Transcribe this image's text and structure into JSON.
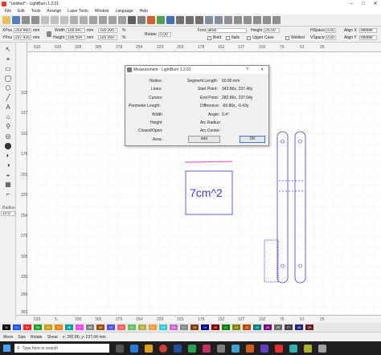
{
  "window": {
    "title": "*untitled* - LightBurn 1.2.01",
    "controls": [
      "–",
      "□",
      "✕"
    ]
  },
  "menu": [
    "File",
    "Edit",
    "Tools",
    "Arrange",
    "Laser Tools",
    "Window",
    "Language",
    "Help"
  ],
  "props": {
    "xpos_label": "XPos",
    "xpos": "263.460",
    "ypos_label": "YPos",
    "ypos": "297.426",
    "width_label": "Width",
    "width": "158.847",
    "height_label": "Height",
    "height": "198.504",
    "unit": "mm",
    "pct_w": "100.000",
    "pct_h": "100.000",
    "pct_sym": "%",
    "rotate_label": "Rotate",
    "rotate": "0.00",
    "font_label": "Font",
    "font": "Arial",
    "height2_label": "Height",
    "height2": "25.00",
    "hspace_label": "HSpace",
    "hspace": "0.00",
    "alignx_label": "Align X",
    "alignx": "Middle",
    "vspace_label": "VSpace",
    "vspace": "0.00",
    "aligny_label": "Align Y",
    "aligny": "Middle",
    "bold": "Bold",
    "italic": "Italic",
    "upper": "Upper Case",
    "welded": "Welded"
  },
  "left_tools": {
    "radius_label": "Radius",
    "radius": "10.0"
  },
  "ruler": {
    "top": [
      "533",
      "530",
      "328",
      "305",
      "279",
      "254",
      "229",
      "203",
      "178",
      "152",
      "127",
      "102",
      "76",
      "51",
      "25"
    ],
    "left": [
      "102",
      "127",
      "152",
      "178",
      "203",
      "229",
      "254",
      "279",
      "305",
      "330",
      "356",
      "381",
      "406",
      "432"
    ],
    "bottom": [
      "533",
      "5..",
      "330",
      "305",
      "279",
      "254",
      "229",
      "203",
      "178",
      "152",
      "127",
      "102",
      "76",
      "51",
      "25"
    ]
  },
  "canvas_text": "7cm^2",
  "dialog": {
    "title": "Measurement - LightBurn 1.2.01",
    "help": "?",
    "close": "✕",
    "rows": [
      {
        "label": "Nodes:",
        "key": "Segment Length:",
        "val": "60.80 mm"
      },
      {
        "label": "Lines:",
        "key": "Start Point:",
        "val": "343.66x, 237.46y"
      },
      {
        "label": "Curves:",
        "key": "End Point:",
        "val": "282.86x, 237.04y"
      },
      {
        "label": "Perimeter Length:",
        "key": "Difference:",
        "val": "-60.80x, -0.43y"
      },
      {
        "label": "Width",
        "key": "Angle:",
        "val": "0.4°"
      },
      {
        "label": "Height",
        "key": "Arc Radius:",
        "val": ""
      },
      {
        "label": "Closed/Open:",
        "key": "Arc Center:",
        "val": ""
      },
      {
        "label": "Area:",
        "key": "",
        "val": ""
      }
    ],
    "mm_button": "mm",
    "ok_button": "OK"
  },
  "palette": [
    "00",
    "01",
    "02",
    "03",
    "04",
    "05",
    "06",
    "07",
    "08",
    "09",
    "10",
    "11",
    "12",
    "13",
    "14",
    "15",
    "16",
    "17",
    "18",
    "19",
    "20",
    "21",
    "22",
    "23",
    "24",
    "25",
    "26",
    "27",
    "28",
    "29"
  ],
  "palette_colors": [
    "#000000",
    "#1e50ff",
    "#ff2020",
    "#20a020",
    "#c8a000",
    "#ff8000",
    "#00a0a0",
    "#ff40ff",
    "#808080",
    "#a05000",
    "#5050ff",
    "#ff6060",
    "#60c060",
    "#b0b040",
    "#ff9933",
    "#33cccc",
    "#cc66cc",
    "#888888",
    "#804000",
    "#000080",
    "#800000",
    "#008000",
    "#808000",
    "#c04000",
    "#008080",
    "#800080",
    "#666666",
    "#404040",
    "#202080",
    "#602020"
  ],
  "status": {
    "move": "Move",
    "size": "Size",
    "rotate": "Rotate",
    "shear": "Shear",
    "coords": "x: 282.86, y: 237.04 mm"
  },
  "taskbar": {
    "search_placeholder": "Type here to search"
  }
}
